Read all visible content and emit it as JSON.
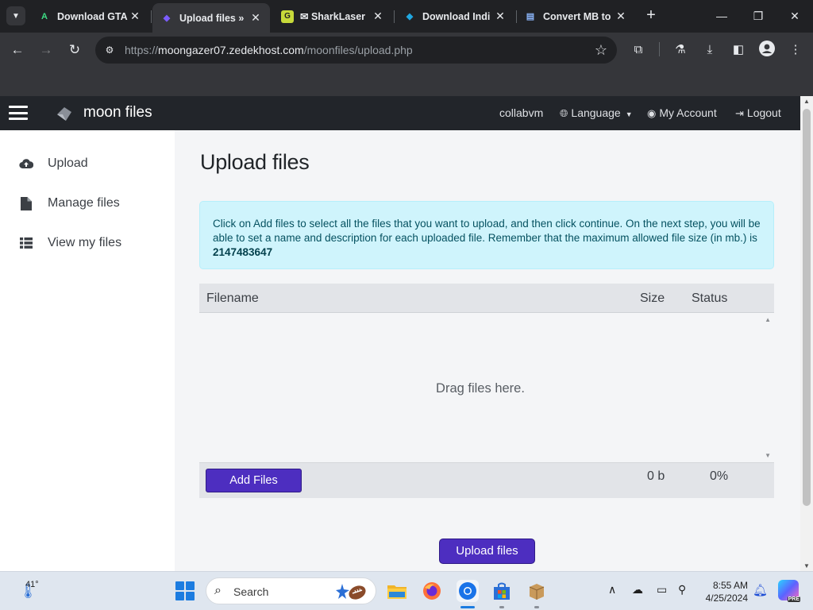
{
  "browser": {
    "tabs": [
      {
        "title": "Download GTA",
        "favicon": "A",
        "favicon_color": "#3ddc84",
        "active": false
      },
      {
        "title": "Upload files » ",
        "favicon": "◆",
        "favicon_color": "#7b5cff",
        "active": true
      },
      {
        "title": "SharkLaser",
        "favicon": "G",
        "favicon_color": "#c7d93a",
        "active": false
      },
      {
        "title": "Download Indi",
        "favicon": "◆",
        "favicon_color": "#20a7e0",
        "active": false
      },
      {
        "title": "Convert MB to",
        "favicon": "▤",
        "favicon_color": "#8ab4f8",
        "active": false
      }
    ],
    "url_scheme": "https://",
    "url_host": "moongazer07.zedekhost.com",
    "url_path": "/moonfiles/upload.php"
  },
  "site": {
    "brand": "moon files",
    "nav": {
      "user": "collabvm",
      "language": "Language",
      "account": "My Account",
      "logout": "Logout"
    },
    "sidebar": [
      {
        "label": "Upload",
        "icon": "cloud-upload-icon"
      },
      {
        "label": "Manage files",
        "icon": "file-icon"
      },
      {
        "label": "View my files",
        "icon": "list-icon"
      }
    ],
    "page_title": "Upload files",
    "alert": {
      "text": "Click on Add files to select all the files that you want to upload, and then click continue. On the next step, you will be able to set a name and description for each uploaded file. Remember that the maximum allowed file size (in mb.) is ",
      "max_size": "2147483647"
    },
    "uploader": {
      "col_filename": "Filename",
      "col_size": "Size",
      "col_status": "Status",
      "drop_text": "Drag files here.",
      "add_button": "Add Files",
      "total_size": "0 b",
      "total_percent": "0%"
    },
    "submit_button": "Upload files"
  },
  "taskbar": {
    "temperature": "41°",
    "search_label": "Search",
    "time": "8:55 AM",
    "date": "4/25/2024",
    "copilot_badge": "PRE"
  },
  "colors": {
    "accent": "#4d2ec0",
    "alert_bg": "#cff4fc",
    "navbar": "#22252a"
  }
}
